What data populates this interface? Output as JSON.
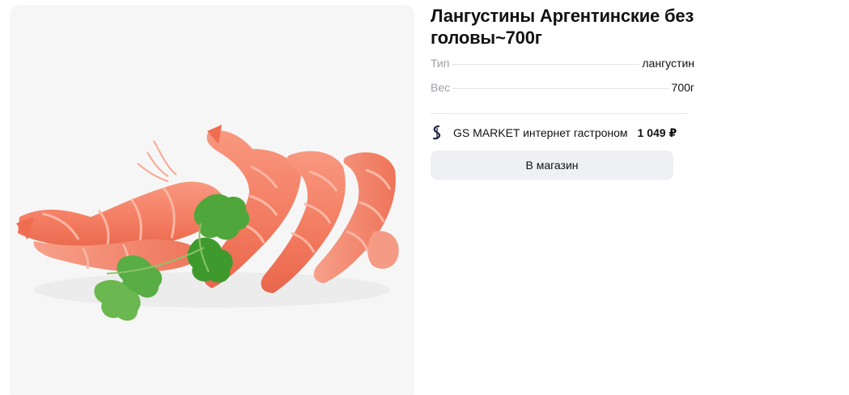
{
  "product": {
    "title": "Лангустины Аргентинские без головы~700г",
    "image_alt": "Лангустины Аргентинские без головы",
    "specs": [
      {
        "label": "Тип",
        "value": "лангустин"
      },
      {
        "label": "Вес",
        "value": "700г"
      }
    ]
  },
  "offer": {
    "shop_icon": "shop-logo-icon",
    "shop_name": "GS MARKET интернет гастроном",
    "price": "1 049 ₽",
    "button_label": "В магазин"
  },
  "colors": {
    "image_background": "#f6f6f6",
    "button_background": "#eef0f4",
    "label_gray": "#9aa0a6",
    "shrimp": "#f4826a",
    "herb": "#3f9a2e"
  }
}
